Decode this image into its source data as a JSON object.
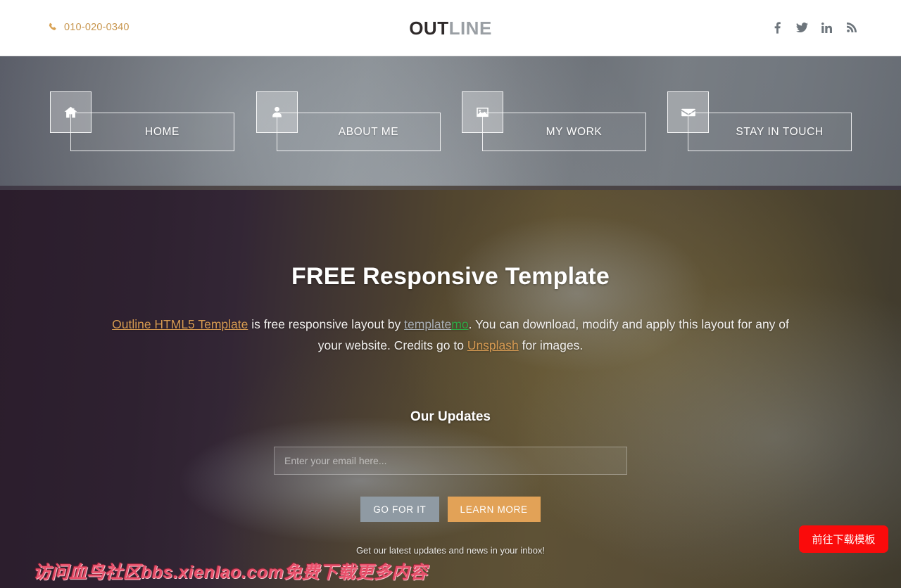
{
  "topbar": {
    "phone": "010-020-0340",
    "phone_icon": "phone-icon",
    "logo_part1": "OUT",
    "logo_part2": "LINE",
    "socials": [
      {
        "name": "facebook-icon",
        "label": "Facebook"
      },
      {
        "name": "twitter-icon",
        "label": "Twitter"
      },
      {
        "name": "linkedin-icon",
        "label": "LinkedIn"
      },
      {
        "name": "rss-icon",
        "label": "RSS"
      }
    ]
  },
  "nav": {
    "items": [
      {
        "label": "HOME",
        "icon": "home-icon"
      },
      {
        "label": "ABOUT ME",
        "icon": "user-icon"
      },
      {
        "label": "MY WORK",
        "icon": "image-icon"
      },
      {
        "label": "STAY IN TOUCH",
        "icon": "envelope-icon"
      }
    ]
  },
  "hero": {
    "title": "FREE Responsive Template",
    "para": {
      "link1": "Outline HTML5 Template",
      "text1": " is free responsive layout by ",
      "link2a": "template",
      "link2b": "mo",
      "text2": ". You can download, modify and apply this layout for any of your website. Credits go to ",
      "link3": "Unsplash",
      "text3": " for images."
    },
    "updates_title": "Our Updates",
    "email_placeholder": "Enter your email here...",
    "email_value": "",
    "btn_go": "GO FOR IT",
    "btn_learn": "LEARN MORE",
    "inbox_note": "Get our latest updates and news in your inbox!"
  },
  "overlays": {
    "watermark": "访问血鸟社区bbs.xienIao.com免费下载更多内容",
    "download_button": "前往下载模板"
  },
  "colors": {
    "accent_orange": "#d69a52",
    "button_orange": "#e2a257",
    "button_gray": "#8f9aa3",
    "download_red": "#fa0b0b",
    "watermark_pink": "#e8506b",
    "logo_dark": "#2f2a2a",
    "logo_gray": "#9a9fa4"
  }
}
